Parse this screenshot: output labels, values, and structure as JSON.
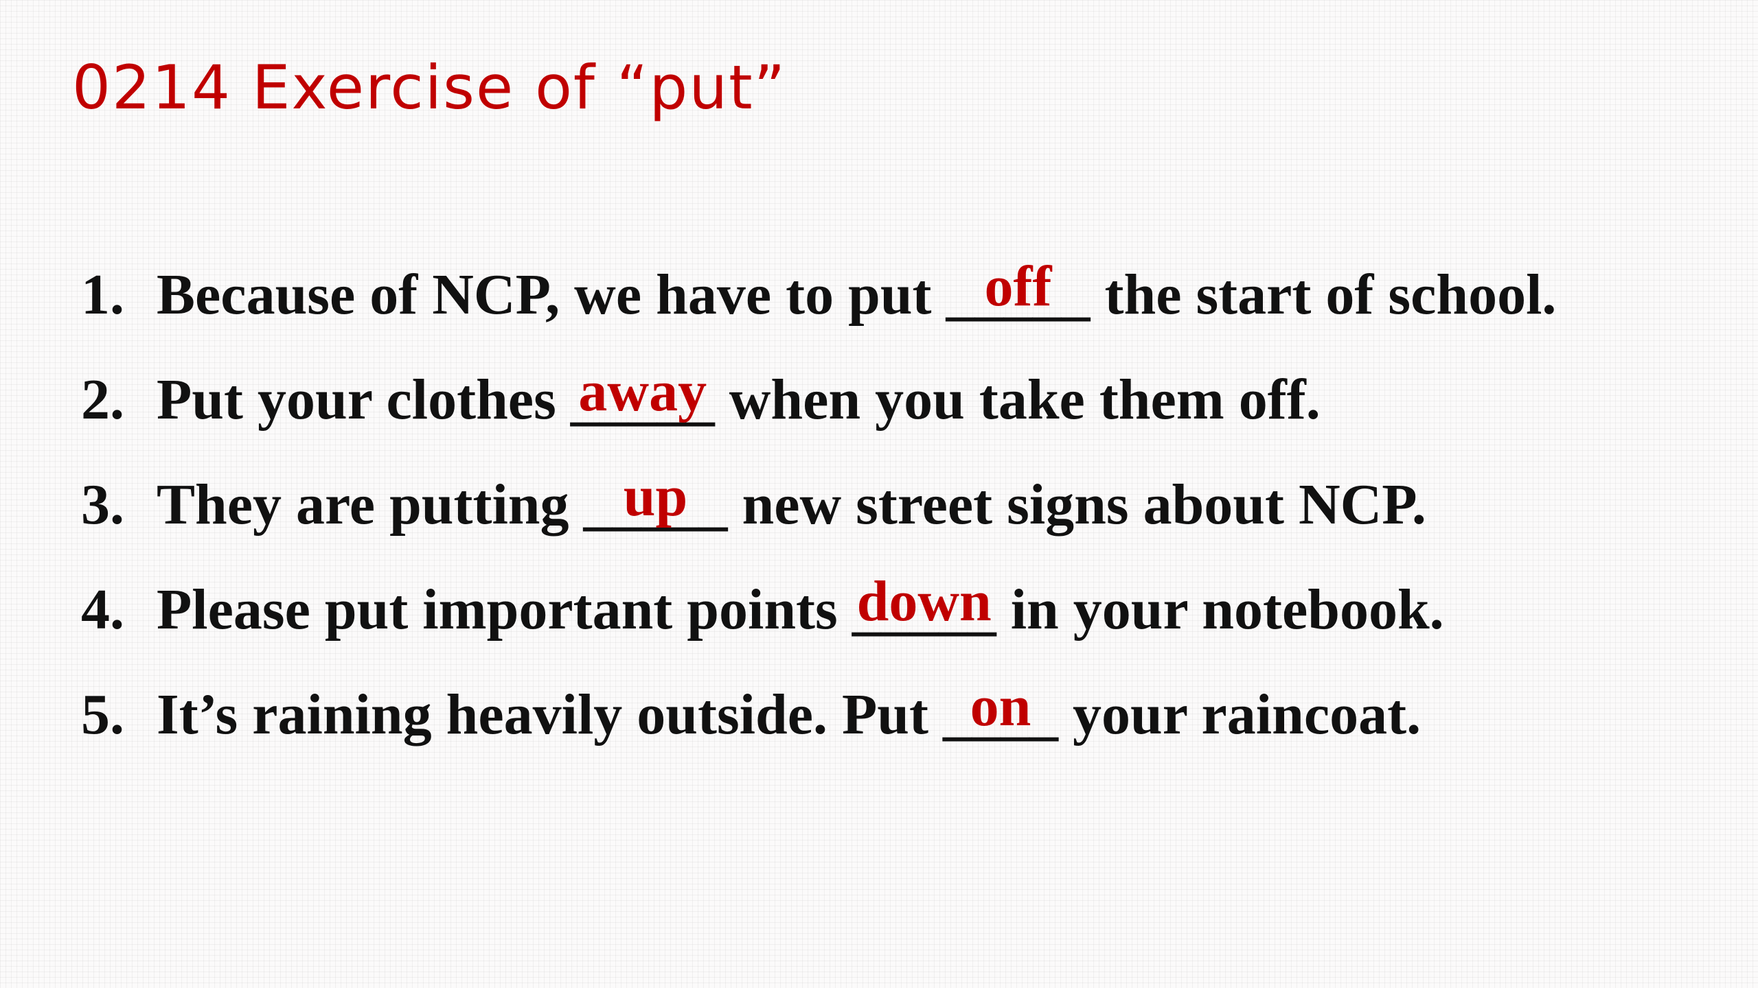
{
  "title": "0214  Exercise of “put”",
  "items": [
    {
      "num": "1.",
      "before": "Because of NCP, we have to put ",
      "blank": "_____",
      "answer": "off",
      "after": " the start of school."
    },
    {
      "num": "2.",
      "before": "Put your clothes ",
      "blank": "_____",
      "answer": "away",
      "after": " when you take them off."
    },
    {
      "num": "3.",
      "before": "They are putting ",
      "blank": "_____",
      "answer": "up",
      "after": " new street signs about NCP."
    },
    {
      "num": "4.",
      "before": "Please put important points ",
      "blank": "_____",
      "answer": "down",
      "after": " in your notebook."
    },
    {
      "num": "5.",
      "before": "It’s raining heavily outside. Put ",
      "blank": "____",
      "answer": "on",
      "after": " your raincoat."
    }
  ],
  "colors": {
    "accent": "#c00000",
    "text": "#111111",
    "background": "#fbfafa"
  }
}
